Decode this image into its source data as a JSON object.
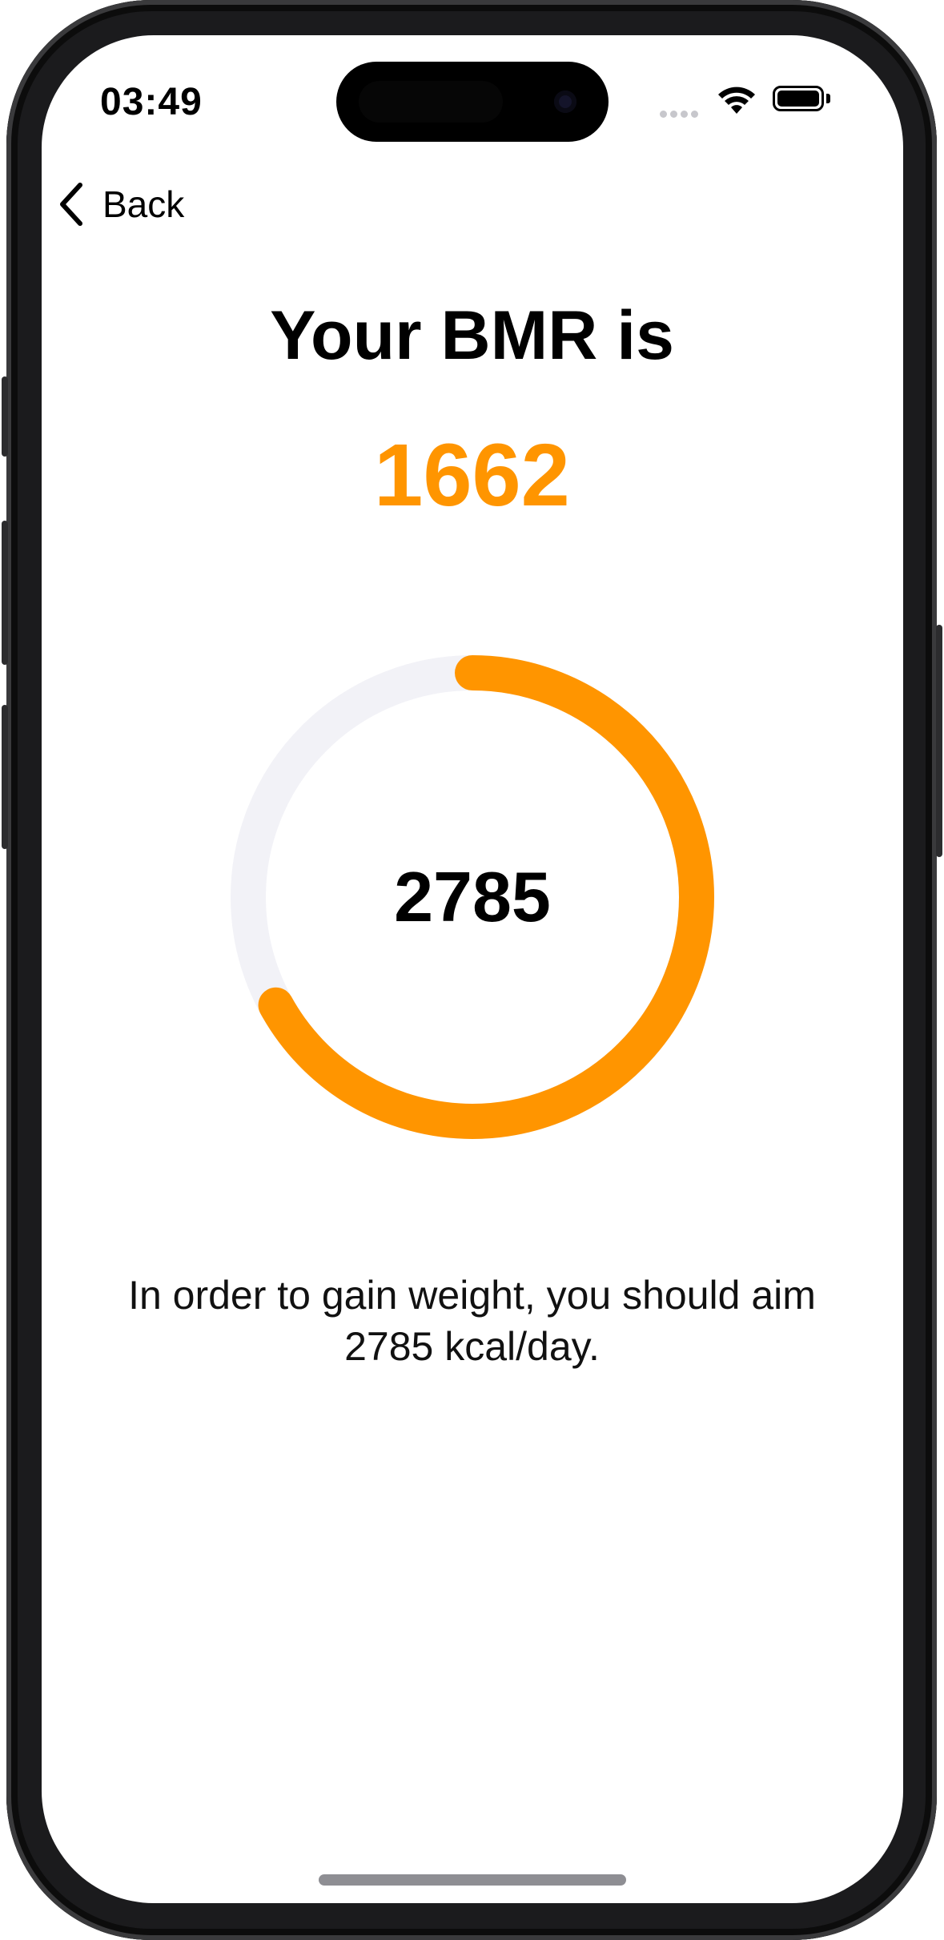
{
  "status_bar": {
    "time": "03:49",
    "icons": [
      "cellular-signal-icon",
      "wifi-icon",
      "battery-icon"
    ]
  },
  "nav": {
    "back_label": "Back",
    "back_icon": "chevron-left-icon"
  },
  "result": {
    "title": "Your BMR is",
    "bmr_value": "1662",
    "target_value": "2785",
    "progress_fraction": 0.67,
    "message_line1": "In order to gain weight, you should aim",
    "message_line2": "2785 kcal/day."
  },
  "colors": {
    "accent": "#FF9500",
    "ring_track": "#F2F2F7",
    "text": "#000000"
  }
}
